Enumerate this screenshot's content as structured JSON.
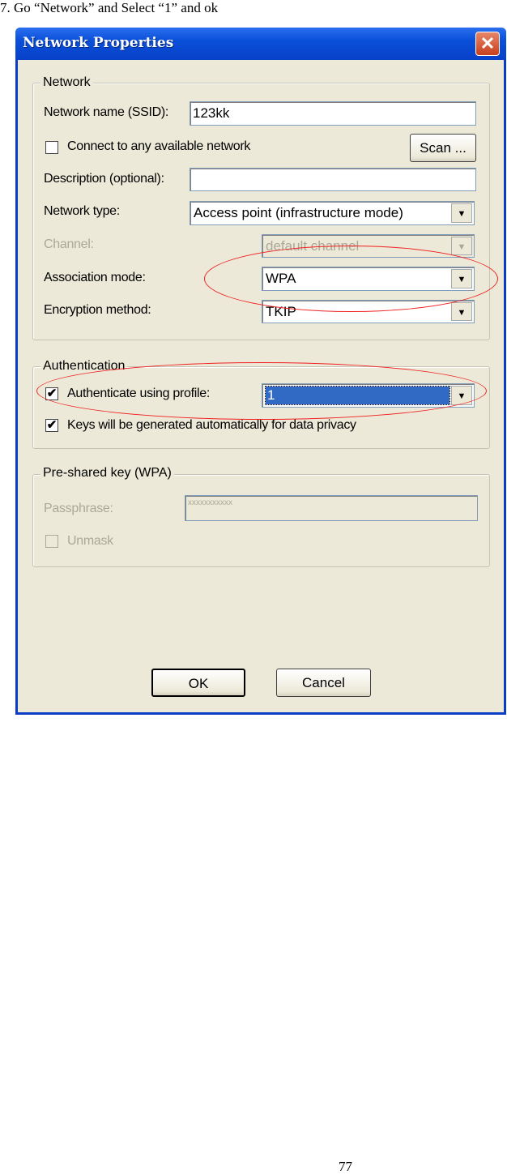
{
  "caption": "7. Go “Network” and Select “1” and ok",
  "page_number": "77",
  "dialog": {
    "title": "Network Properties",
    "close_icon": "close-x-icon",
    "network_group": {
      "legend": "Network",
      "ssid_label": "Network name (SSID):",
      "ssid_value": "123kk",
      "connect_any_label": "Connect to any available network",
      "connect_any_checked": false,
      "scan_label": "Scan ...",
      "description_label": "Description (optional):",
      "description_value": "",
      "network_type_label": "Network type:",
      "network_type_value": "Access point (infrastructure mode)",
      "channel_label": "Channel:",
      "channel_value": "default channel",
      "association_label": "Association mode:",
      "association_value": "WPA",
      "encryption_label": "Encryption method:",
      "encryption_value": "TKIP"
    },
    "auth_group": {
      "legend": "Authentication",
      "profile_label": "Authenticate using profile:",
      "profile_checked": true,
      "profile_value": "1",
      "keys_label": "Keys will be generated automatically for data privacy",
      "keys_checked": true
    },
    "psk_group": {
      "legend": "Pre-shared key (WPA)",
      "passphrase_label": "Passphrase:",
      "passphrase_value": "xxxxxxxxxxx",
      "unmask_label": "Unmask",
      "unmask_checked": false
    },
    "ok_label": "OK",
    "cancel_label": "Cancel",
    "highlight_color": "#f02020"
  }
}
